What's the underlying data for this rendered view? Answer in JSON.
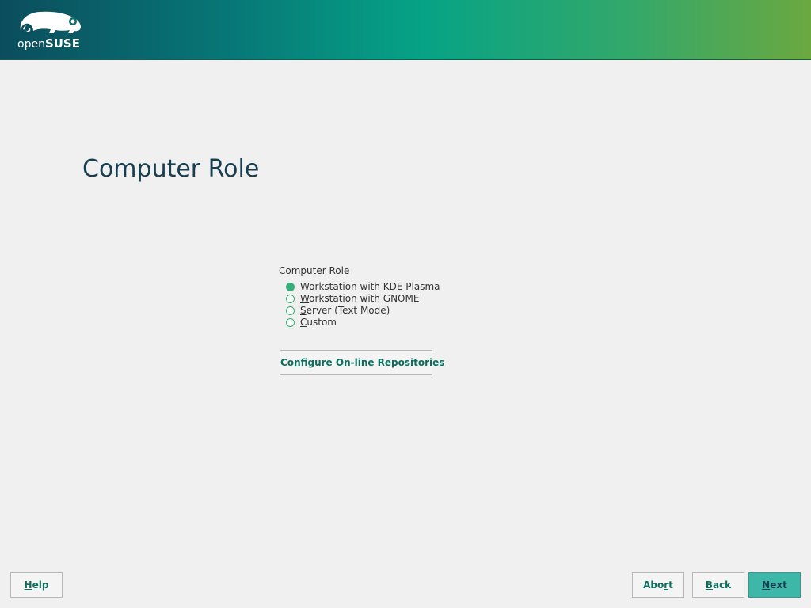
{
  "brand": {
    "logo_open": "open",
    "logo_suse": "SUSE",
    "logo_icon": "chameleon-logo-icon"
  },
  "page": {
    "title": "Computer Role"
  },
  "role_selector": {
    "label": "Computer Role",
    "selected_index": 0,
    "options": [
      {
        "pre": "Wor",
        "mnemonic": "k",
        "post": "station with KDE Plasma",
        "checked": true
      },
      {
        "pre": "",
        "mnemonic": "W",
        "post": "orkstation with GNOME",
        "checked": false
      },
      {
        "pre": "",
        "mnemonic": "S",
        "post": "erver (Text Mode)",
        "checked": false
      },
      {
        "pre": "",
        "mnemonic": "C",
        "post": "ustom",
        "checked": false
      }
    ]
  },
  "repos_button": {
    "pre": "Co",
    "mnemonic": "n",
    "post": "figure On-line Repositories"
  },
  "footer": {
    "help": {
      "pre": "",
      "mnemonic": "H",
      "post": "elp"
    },
    "abort": {
      "pre": "Abo",
      "mnemonic": "r",
      "post": "t"
    },
    "back": {
      "pre": "",
      "mnemonic": "B",
      "post": "ack"
    },
    "next": {
      "pre": "",
      "mnemonic": "N",
      "post": "ext"
    }
  },
  "colors": {
    "accent": "#35b07a",
    "button_text": "#0d6e5e",
    "next_bg": "#3db8a8",
    "title": "#173f4f"
  }
}
